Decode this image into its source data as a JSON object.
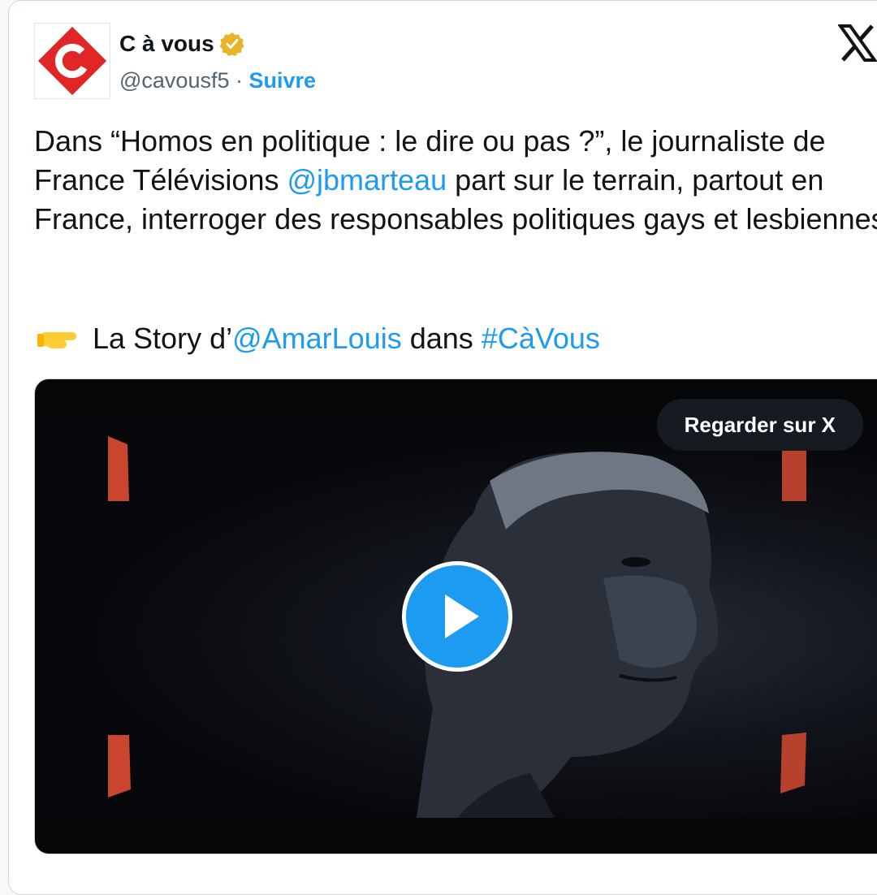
{
  "account": {
    "name": "C à vous",
    "handle": "@cavousf5",
    "separator": "·",
    "follow_label": "Suivre"
  },
  "tweet": {
    "part1": "Dans “Homos en politique : le dire ou pas ?”, le journaliste de France Télévisions ",
    "mention1": "@jbmarteau",
    "part2": " part sur le terrain, partout en France, interroger des responsables politiques gays et lesbiennes",
    "emoji": "pointing-right-hand",
    "part3": " La Story d’",
    "mention2": "@AmarLouis",
    "part4": " dans ",
    "hashtag": "#CàVous"
  },
  "media": {
    "watch_label": "Regarder sur X",
    "play_icon": "play-icon"
  },
  "colors": {
    "link": "#1d9bf0",
    "brand_red": "#e02626",
    "verified_gold": "#e8b32a"
  }
}
